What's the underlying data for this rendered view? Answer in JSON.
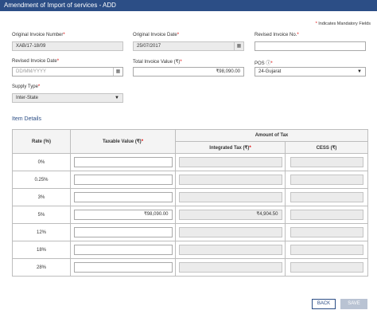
{
  "header": {
    "title": "Amendment of Import of services - ADD"
  },
  "mandatory_note": "Indicates Mandatory Fields",
  "form": {
    "original_invoice_number": {
      "label": "Original Invoice Number",
      "value": "XAB/17-18/09"
    },
    "original_invoice_date": {
      "label": "Original Invoice Date",
      "value": "25/07/2017"
    },
    "revised_invoice_no": {
      "label": "Revised Invoice No.",
      "value": ""
    },
    "revised_invoice_date": {
      "label": "Revised Invoice Date",
      "placeholder": "DD/MM/YYYY"
    },
    "total_invoice_value": {
      "label": "Total Invoice Value (₹)",
      "value": "₹98,090.00"
    },
    "pos": {
      "label": "POS",
      "value": "24-Gujarat"
    },
    "supply_type": {
      "label": "Supply Type",
      "value": "Inter-State"
    }
  },
  "item_details": {
    "title": "Item Details",
    "headers": {
      "rate": "Rate (%)",
      "taxable_value": "Taxable Value (₹)",
      "amount_of_tax": "Amount of Tax",
      "integrated_tax": "Integrated Tax (₹)",
      "cess": "CESS (₹)"
    },
    "rows": [
      {
        "rate": "0%",
        "taxable_value": "",
        "integrated_tax": "",
        "cess": ""
      },
      {
        "rate": "0.25%",
        "taxable_value": "",
        "integrated_tax": "",
        "cess": ""
      },
      {
        "rate": "3%",
        "taxable_value": "",
        "integrated_tax": "",
        "cess": ""
      },
      {
        "rate": "5%",
        "taxable_value": "₹98,090.00",
        "integrated_tax": "₹4,904.50",
        "cess": ""
      },
      {
        "rate": "12%",
        "taxable_value": "",
        "integrated_tax": "",
        "cess": ""
      },
      {
        "rate": "18%",
        "taxable_value": "",
        "integrated_tax": "",
        "cess": ""
      },
      {
        "rate": "28%",
        "taxable_value": "",
        "integrated_tax": "",
        "cess": ""
      }
    ]
  },
  "buttons": {
    "back": "BACK",
    "save": "SAVE"
  },
  "colors": {
    "header_bg": "#2c4e86",
    "required_star": "#e00000",
    "section_title": "#2c4e86",
    "save_disabled": "#b9c3d3"
  },
  "icons": {
    "calendar": "calendar-icon",
    "dropdown": "chevron-down-icon",
    "info": "info-icon"
  }
}
